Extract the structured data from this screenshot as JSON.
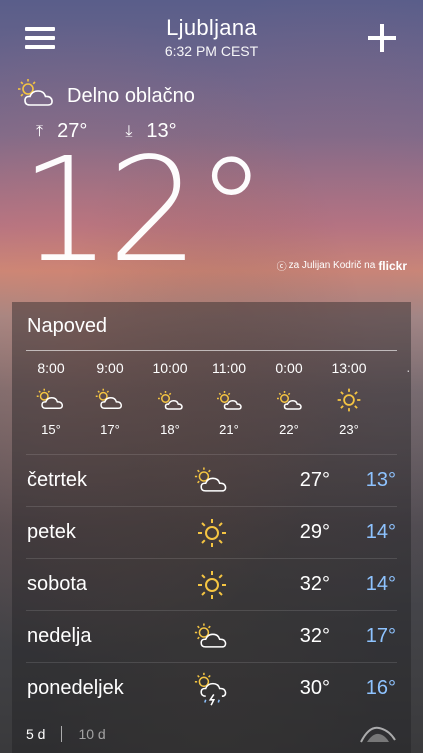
{
  "header": {
    "city": "Ljubljana",
    "time": "6:32 PM CEST"
  },
  "current": {
    "condition": "Delno oblačno",
    "high": "27°",
    "low": "13°",
    "temperature": "12°",
    "credit_text": "za Julijan Kodrič na",
    "credit_brand": "flickr"
  },
  "forecast": {
    "title": "Napoved",
    "hourly": [
      {
        "time": "8:00",
        "icon": "sun-cloud-icon",
        "temp": "15°"
      },
      {
        "time": "9:00",
        "icon": "sun-cloud-icon",
        "temp": "17°"
      },
      {
        "time": "10:00",
        "icon": "sun-cloud-icon",
        "temp": "18°"
      },
      {
        "time": "11:00",
        "icon": "sun-cloud-icon",
        "temp": "21°"
      },
      {
        "time": "0:00",
        "icon": "sun-cloud-icon",
        "temp": "22°"
      },
      {
        "time": "13:00",
        "icon": "sun-icon",
        "temp": "23°"
      }
    ],
    "daily": [
      {
        "day": "četrtek",
        "icon": "sun-cloud-icon",
        "high": "27°",
        "low": "13°"
      },
      {
        "day": "petek",
        "icon": "sun-icon",
        "high": "29°",
        "low": "14°"
      },
      {
        "day": "sobota",
        "icon": "sun-icon",
        "high": "32°",
        "low": "14°"
      },
      {
        "day": "nedelja",
        "icon": "sun-cloud-icon",
        "high": "32°",
        "low": "17°"
      },
      {
        "day": "ponedeljek",
        "icon": "thunderstorm-icon",
        "high": "30°",
        "low": "16°"
      }
    ],
    "tabs": {
      "five_day": "5 d",
      "ten_day": "10 d"
    }
  },
  "colors": {
    "low_temp": "#8ec3ff",
    "sun": "#f5c542"
  }
}
